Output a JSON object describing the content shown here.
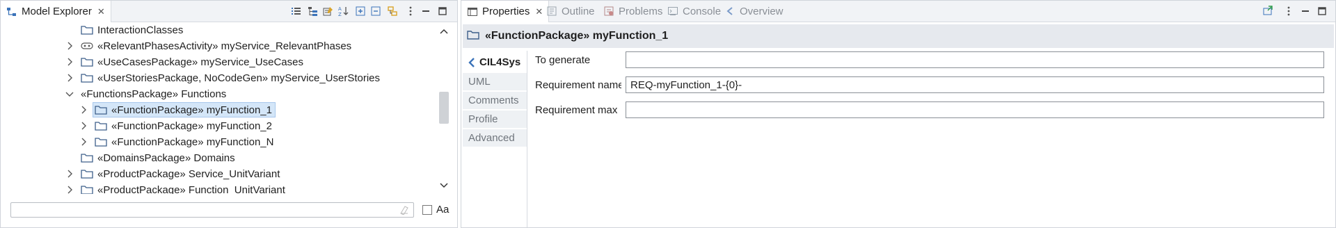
{
  "model_explorer": {
    "tab_label": "Model Explorer",
    "tree": [
      {
        "label": "InteractionClasses",
        "level": 0,
        "expander": "none",
        "icon": "folder-icon"
      },
      {
        "label": "«RelevantPhasesActivity» myService_RelevantPhases",
        "level": 0,
        "expander": "collapsed",
        "icon": "activity-icon"
      },
      {
        "label": "«UseCasesPackage» myService_UseCases",
        "level": 0,
        "expander": "collapsed",
        "icon": "folder-icon"
      },
      {
        "label": "«UserStoriesPackage, NoCodeGen» myService_UserStories",
        "level": 0,
        "expander": "collapsed",
        "icon": "folder-icon"
      },
      {
        "label": "«FunctionsPackage» Functions",
        "level": 0,
        "expander": "expanded",
        "icon": "none"
      },
      {
        "label": "«FunctionPackage» myFunction_1",
        "level": 1,
        "expander": "collapsed",
        "icon": "folder-icon",
        "selected": true
      },
      {
        "label": "«FunctionPackage» myFunction_2",
        "level": 1,
        "expander": "collapsed",
        "icon": "folder-icon"
      },
      {
        "label": "«FunctionPackage» myFunction_N",
        "level": 1,
        "expander": "collapsed",
        "icon": "folder-icon"
      },
      {
        "label": "«DomainsPackage» Domains",
        "level": 0,
        "expander": "none",
        "icon": "folder-icon"
      },
      {
        "label": "«ProductPackage» Service_UnitVariant",
        "level": 0,
        "expander": "collapsed",
        "icon": "folder-icon"
      },
      {
        "label": "«ProductPackage» Function_UnitVariant",
        "level": 0,
        "expander": "collapsed",
        "icon": "folder-icon"
      }
    ],
    "filter": {
      "value": "",
      "placeholder": ""
    },
    "case_sensitive_label": "Aa"
  },
  "right_tabs": [
    {
      "label": "Properties",
      "active": true
    },
    {
      "label": "Outline"
    },
    {
      "label": "Problems"
    },
    {
      "label": "Console"
    },
    {
      "label": "Overview"
    }
  ],
  "properties": {
    "title": "«FunctionPackage» myFunction_1",
    "side_tabs": [
      "CIL4Sys",
      "UML",
      "Comments",
      "Profile",
      "Advanced"
    ],
    "fields": [
      {
        "label": "To generate",
        "value": ""
      },
      {
        "label": "Requirement name",
        "value": "REQ-myFunction_1-{0}-"
      },
      {
        "label": "Requirement max",
        "value": ""
      }
    ]
  },
  "colors": {
    "selection": "#d4e6f8",
    "tab_bar": "#f1f3f6",
    "header_bg": "#e6e9ee"
  }
}
